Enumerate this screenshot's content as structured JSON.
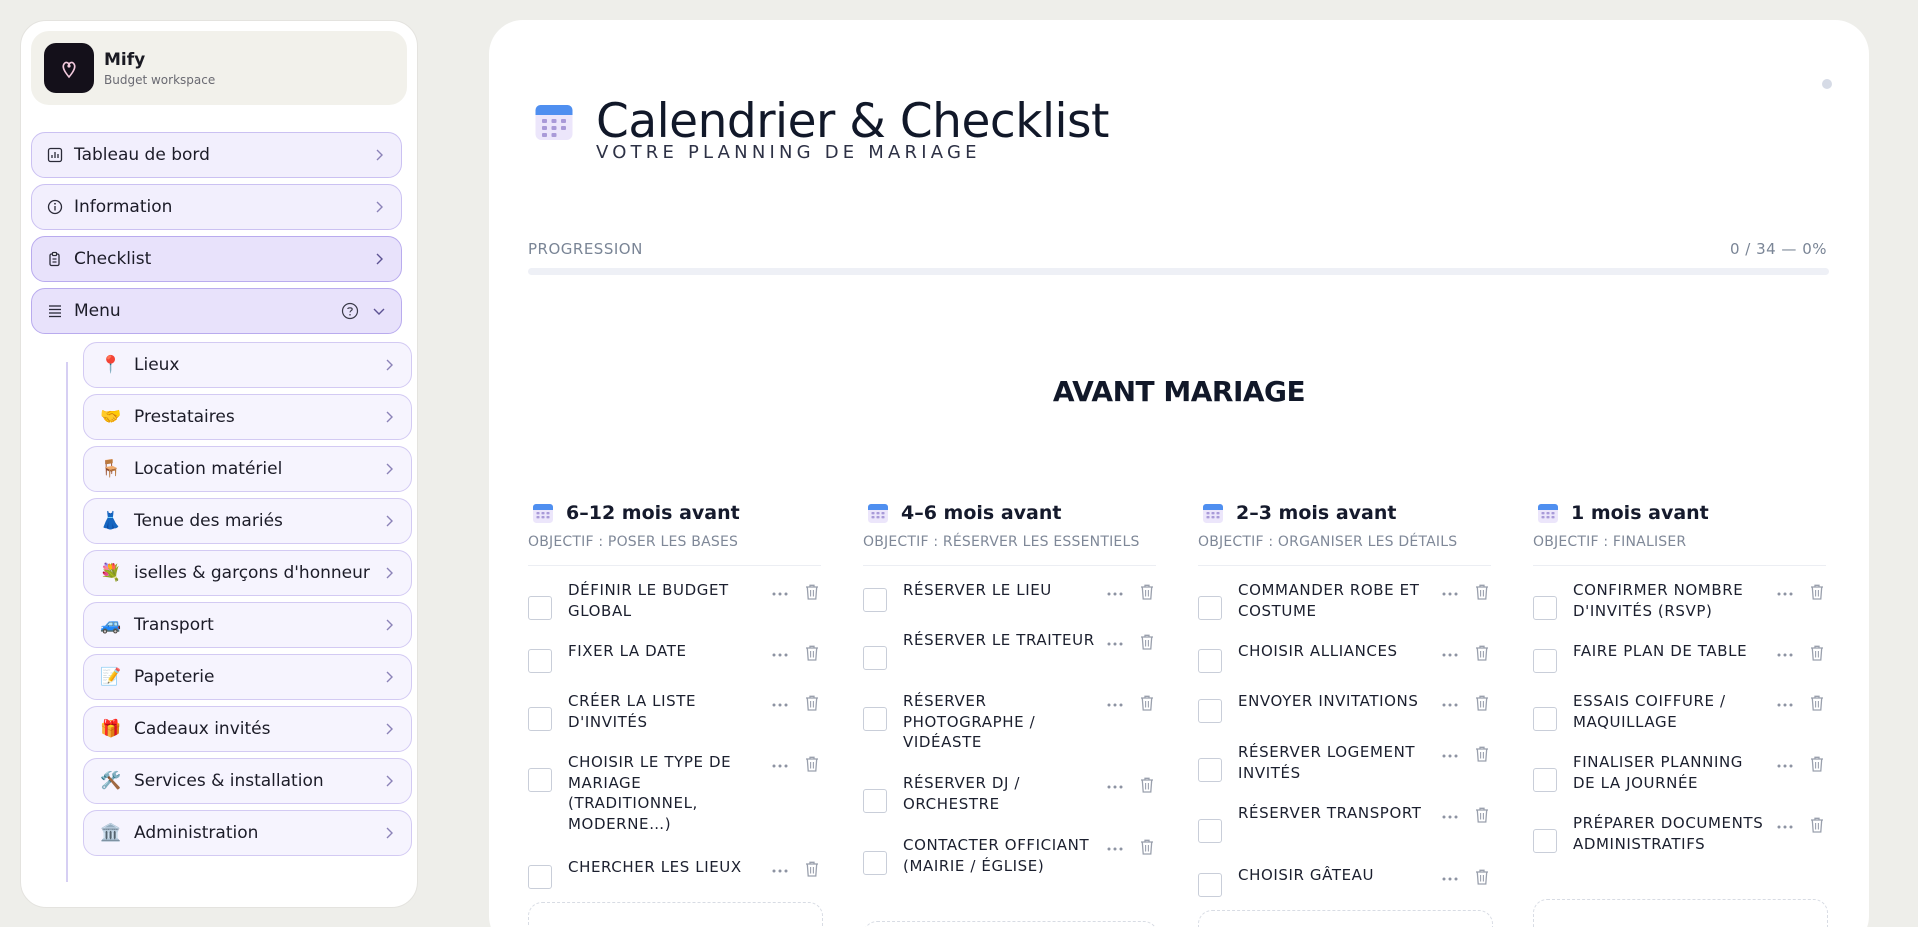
{
  "brand": {
    "name": "Mify",
    "subtitle": "Budget workspace"
  },
  "nav": {
    "dashboard": "Tableau de bord",
    "information": "Information",
    "checklist": "Checklist",
    "menu": "Menu"
  },
  "menu_items": [
    {
      "icon": "📍",
      "icon_name": "pin-icon",
      "label": "Lieux"
    },
    {
      "icon": "🤝",
      "icon_name": "handshake-icon",
      "label": "Prestataires"
    },
    {
      "icon": "🪑",
      "icon_name": "chair-icon",
      "label": "Location matériel"
    },
    {
      "icon": "👗",
      "icon_name": "dress-icon",
      "label": "Tenue des mariés"
    },
    {
      "icon": "💐",
      "icon_name": "bouquet-icon",
      "label": "iselles & garçons d'honneur"
    },
    {
      "icon": "🚙",
      "icon_name": "car-icon",
      "label": "Transport"
    },
    {
      "icon": "📝",
      "icon_name": "memo-icon",
      "label": "Papeterie"
    },
    {
      "icon": "🎁",
      "icon_name": "gift-icon",
      "label": "Cadeaux invités"
    },
    {
      "icon": "🛠️",
      "icon_name": "tools-icon",
      "label": "Services & installation"
    },
    {
      "icon": "🏛️",
      "icon_name": "building-icon",
      "label": "Administration"
    }
  ],
  "page": {
    "title": "Calendrier & Checklist",
    "subtitle": "VOTRE PLANNING DE MARIAGE"
  },
  "progress": {
    "label": "PROGRESSION",
    "value_text": "0 / 34 — 0%",
    "fraction": 0.0
  },
  "section": {
    "title": "AVANT MARIAGE"
  },
  "columns": [
    {
      "title": "6–12 mois avant",
      "objective": "OBJECTIF : POSER LES BASES",
      "tasks": [
        "Définir le budget global",
        "Fixer la date",
        "Créer la liste d'invités",
        "Choisir le type de mariage (traditionnel, moderne…)",
        "Chercher les lieux"
      ]
    },
    {
      "title": "4–6 mois avant",
      "objective": "OBJECTIF : RÉSERVER LES ESSENTIELS",
      "tasks": [
        "Réserver le lieu",
        "Réserver le traiteur",
        "Réserver photographe / vidéaste",
        "Réserver DJ / orchestre",
        "Contacter officiant (mairie / église)"
      ]
    },
    {
      "title": "2–3 mois avant",
      "objective": "OBJECTIF : ORGANISER LES DÉTAILS",
      "tasks": [
        "Commander robe et costume",
        "Choisir alliances",
        "Envoyer invitations",
        "Réserver logement invités",
        "Réserver transport",
        "Choisir gâteau"
      ]
    },
    {
      "title": "1 mois avant",
      "objective": "OBJECTIF : FINALISER",
      "tasks": [
        "Confirmer nombre d'invités (RSVP)",
        "Faire plan de table",
        "Essais coiffure / maquillage",
        "Finaliser planning de la journée",
        "Préparer documents administratifs"
      ]
    }
  ],
  "colors": {
    "accent": "#9b8ae6",
    "nav_bg": "#f2effd",
    "nav_border": "#cbc1f2"
  }
}
